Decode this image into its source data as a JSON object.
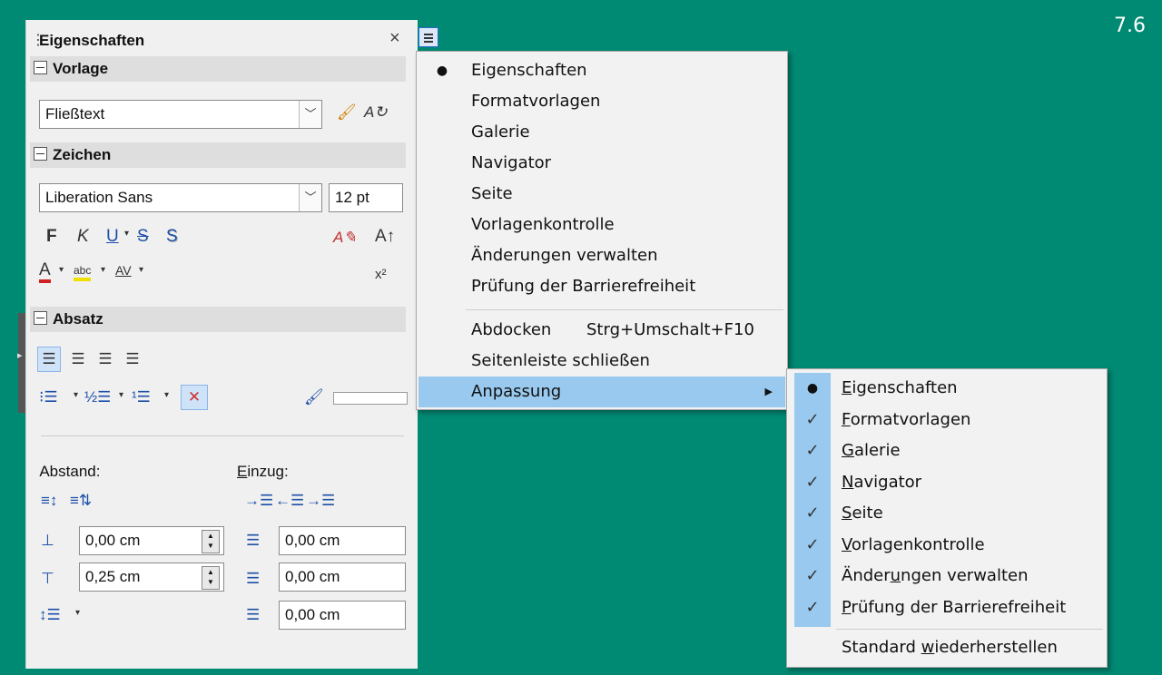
{
  "version": "7.6",
  "panel": {
    "title": "Eigenschaften",
    "close_glyph": "×",
    "sections": {
      "vorlage": "Vorlage",
      "zeichen": "Zeichen",
      "absatz": "Absatz"
    },
    "style_value": "Fließtext",
    "font_value": "Liberation Sans",
    "size_value": "12 pt",
    "format_letters": {
      "bold": "F",
      "italic": "K",
      "underline": "U",
      "strike": "S",
      "shadow": "S"
    },
    "superscript": "x²",
    "fontcolor_letter": "A",
    "highlight_letter": "abc",
    "spacing_letters": "AV",
    "abstand_label": "Abstand:",
    "einzug_label": "Einzug:",
    "einzug_underline": "E",
    "einzug_rest": "inzug:",
    "abstand_above": "0,00 cm",
    "abstand_below": "0,25 cm",
    "indent_before": "0,00 cm",
    "indent_after": "0,00 cm",
    "indent_first": "0,00 cm"
  },
  "menu": {
    "items": [
      {
        "label": "Eigenschaften",
        "marker": "●"
      },
      {
        "label": "Formatvorlagen",
        "marker": ""
      },
      {
        "label": "Galerie",
        "marker": ""
      },
      {
        "label": "Navigator",
        "marker": ""
      },
      {
        "label": "Seite",
        "marker": ""
      },
      {
        "label": "Vorlagenkontrolle",
        "marker": ""
      },
      {
        "label": "Änderungen verwalten",
        "marker": ""
      },
      {
        "label": "Prüfung der Barrierefreiheit",
        "marker": ""
      }
    ],
    "undock_label": "Abdocken",
    "undock_shortcut": "Strg+Umschalt+F10",
    "close_sidebar": "Seitenleiste schließen",
    "customize": "Anpassung",
    "arrow": "▶"
  },
  "submenu": {
    "items": [
      {
        "u": "E",
        "rest": "igenschaften",
        "marker": "●"
      },
      {
        "u": "F",
        "rest": "ormatvorlagen",
        "marker": "✓"
      },
      {
        "u": "G",
        "rest": "alerie",
        "marker": "✓"
      },
      {
        "u": "N",
        "rest": "avigator",
        "marker": "✓"
      },
      {
        "u": "S",
        "rest": "eite",
        "marker": "✓"
      },
      {
        "u": "V",
        "rest": "orlagenkontrolle",
        "marker": "✓"
      },
      {
        "pre": "Änder",
        "u": "u",
        "rest": "ngen verwalten",
        "marker": "✓"
      },
      {
        "u": "P",
        "rest": "rüfung der Barrierefreiheit",
        "marker": "✓"
      }
    ],
    "reset_pre": "Standard ",
    "reset_u": "w",
    "reset_rest": "iederherstellen"
  },
  "colors": {
    "background": "#008a73",
    "highlight": "#99c9ee",
    "font_color_bar": "#d02020",
    "highlight_color_bar": "#f0e000"
  }
}
